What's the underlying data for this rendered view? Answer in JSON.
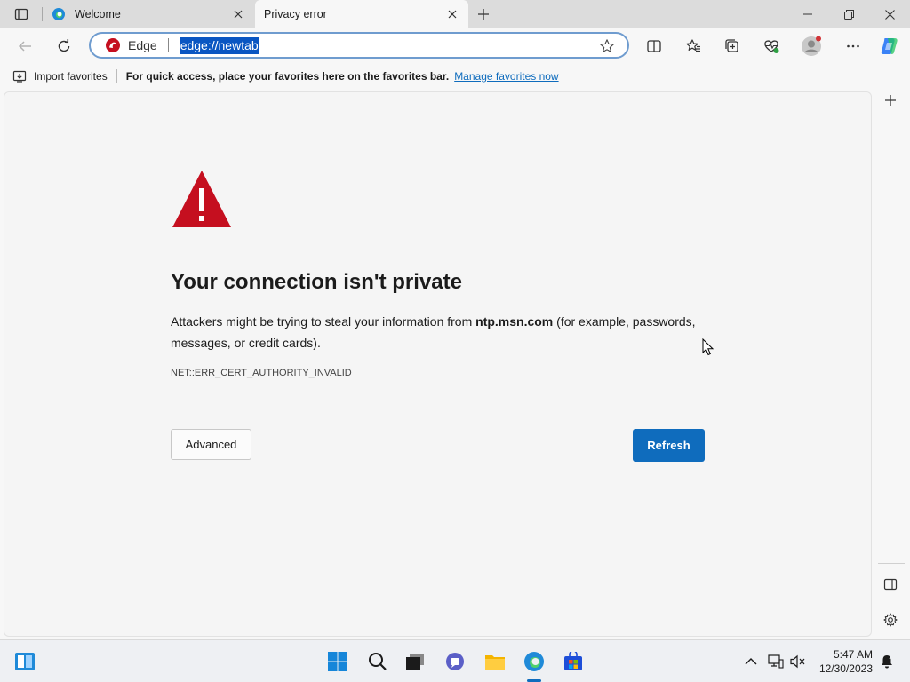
{
  "tabs": [
    {
      "title": "Welcome",
      "favicon": "edge-icon",
      "active": false
    },
    {
      "title": "Privacy error",
      "favicon": "none",
      "active": true
    }
  ],
  "address_bar": {
    "site_label": "Edge",
    "url": "edge://newtab"
  },
  "favorites_bar": {
    "import_label": "Import favorites",
    "message": "For quick access, place your favorites here on the favorites bar.",
    "manage_link": "Manage favorites now"
  },
  "error_page": {
    "heading": "Your connection isn't private",
    "description_prefix": "Attackers might be trying to steal your information from ",
    "host": "ntp.msn.com",
    "description_suffix": " (for example, passwords, messages, or credit cards).",
    "error_code": "NET::ERR_CERT_AUTHORITY_INVALID",
    "advanced_label": "Advanced",
    "refresh_label": "Refresh"
  },
  "taskbar": {
    "time": "5:47 AM",
    "date": "12/30/2023"
  },
  "colors": {
    "accent": "#0f6cbd",
    "warning_red": "#c50f1f",
    "url_highlight": "#0a56c2"
  }
}
